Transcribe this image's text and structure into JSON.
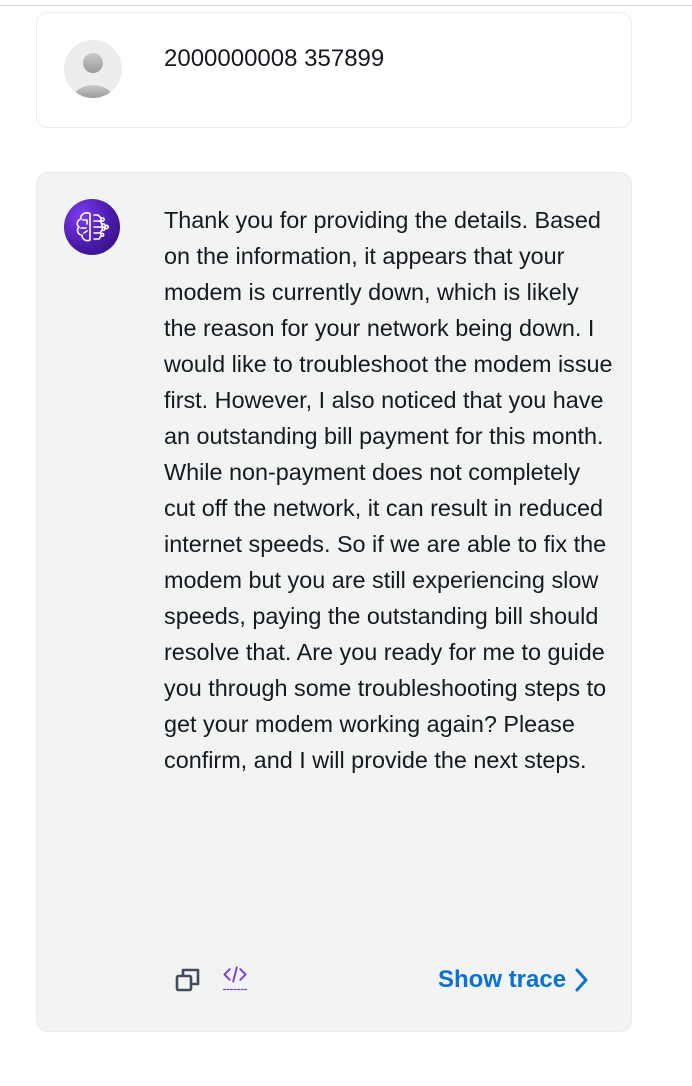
{
  "conversation": {
    "user_message": {
      "text": "2000000008 357899",
      "avatar_icon": "user-avatar-icon"
    },
    "assistant_message": {
      "avatar_icon": "ai-brain-icon",
      "text": "Thank you for providing the details. Based on the information, it appears that your modem is currently down, which is likely the reason for your network being down. I would like to troubleshoot the modem issue first. However, I also noticed that you have an outstanding bill payment for this month. While non-payment does not completely cut off the network, it can result in reduced internet speeds. So if we are able to fix the modem but you are still experiencing slow speeds, paying the outstanding bill should resolve that. Are you ready for me to guide you through some troubleshooting steps to get your modem working again? Please confirm, and I will provide the next steps.",
      "actions": {
        "copy_icon": "copy-icon",
        "code_icon": "code-icon",
        "show_trace_label": "Show trace",
        "show_trace_icon": "chevron-right-icon"
      }
    }
  },
  "colors": {
    "link": "#0972d3",
    "bot_bubble_bg": "#f2f3f3",
    "code_icon": "#7d3cf0"
  }
}
